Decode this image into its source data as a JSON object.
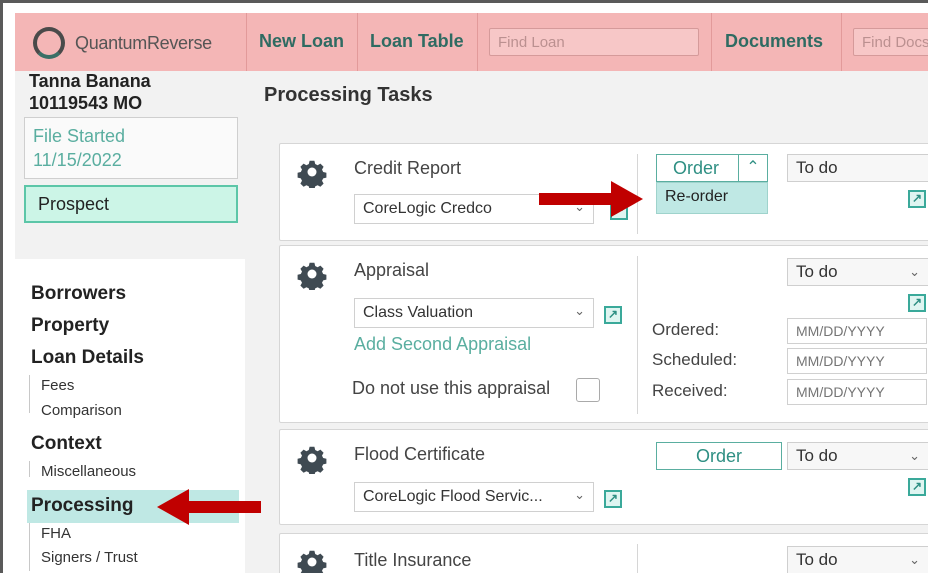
{
  "header": {
    "logo_text": "QuantumReverse",
    "new_loan": "New Loan",
    "loan_table": "Loan Table",
    "find_loan_placeholder": "Find Loan",
    "documents": "Documents",
    "find_docs_placeholder": "Find Docs"
  },
  "borrower": {
    "name": "Tanna Banana",
    "id_state": "10119543   MO",
    "file_status": "File Started",
    "file_date": "11/15/2022",
    "stage": "Prospect"
  },
  "sidebar": {
    "borrowers": "Borrowers",
    "property": "Property",
    "loan_details": "Loan Details",
    "fees": "Fees",
    "comparison": "Comparison",
    "context": "Context",
    "miscellaneous": "Miscellaneous",
    "processing": "Processing",
    "fha": "FHA",
    "signers": "Signers / Trust"
  },
  "main": {
    "title": "Processing Tasks",
    "tasks": [
      {
        "name": "Credit Report",
        "vendor": "CoreLogic Credco",
        "button": "Order",
        "dropdown_item": "Re-order",
        "status": "To do"
      },
      {
        "name": "Appraisal",
        "vendor": "Class Valuation",
        "add_link": "Add Second Appraisal",
        "checkbox_label": "Do not use this appraisal",
        "status": "To do",
        "ordered_label": "Ordered:",
        "scheduled_label": "Scheduled:",
        "received_label": "Received:",
        "date_placeholder": "MM/DD/YYYY"
      },
      {
        "name": "Flood Certificate",
        "vendor": "CoreLogic Flood Servic...",
        "button": "Order",
        "status": "To do"
      },
      {
        "name": "Title Insurance",
        "status": "To do"
      }
    ]
  },
  "colors": {
    "topbar": "#f4b6b6",
    "accent": "#2e8f83",
    "arrow": "#c00000",
    "active_nav": "#bfe8e4"
  },
  "icons": {
    "gear": "gear-icon",
    "link": "open-external-icon",
    "chevron": "chevron-down-icon"
  }
}
